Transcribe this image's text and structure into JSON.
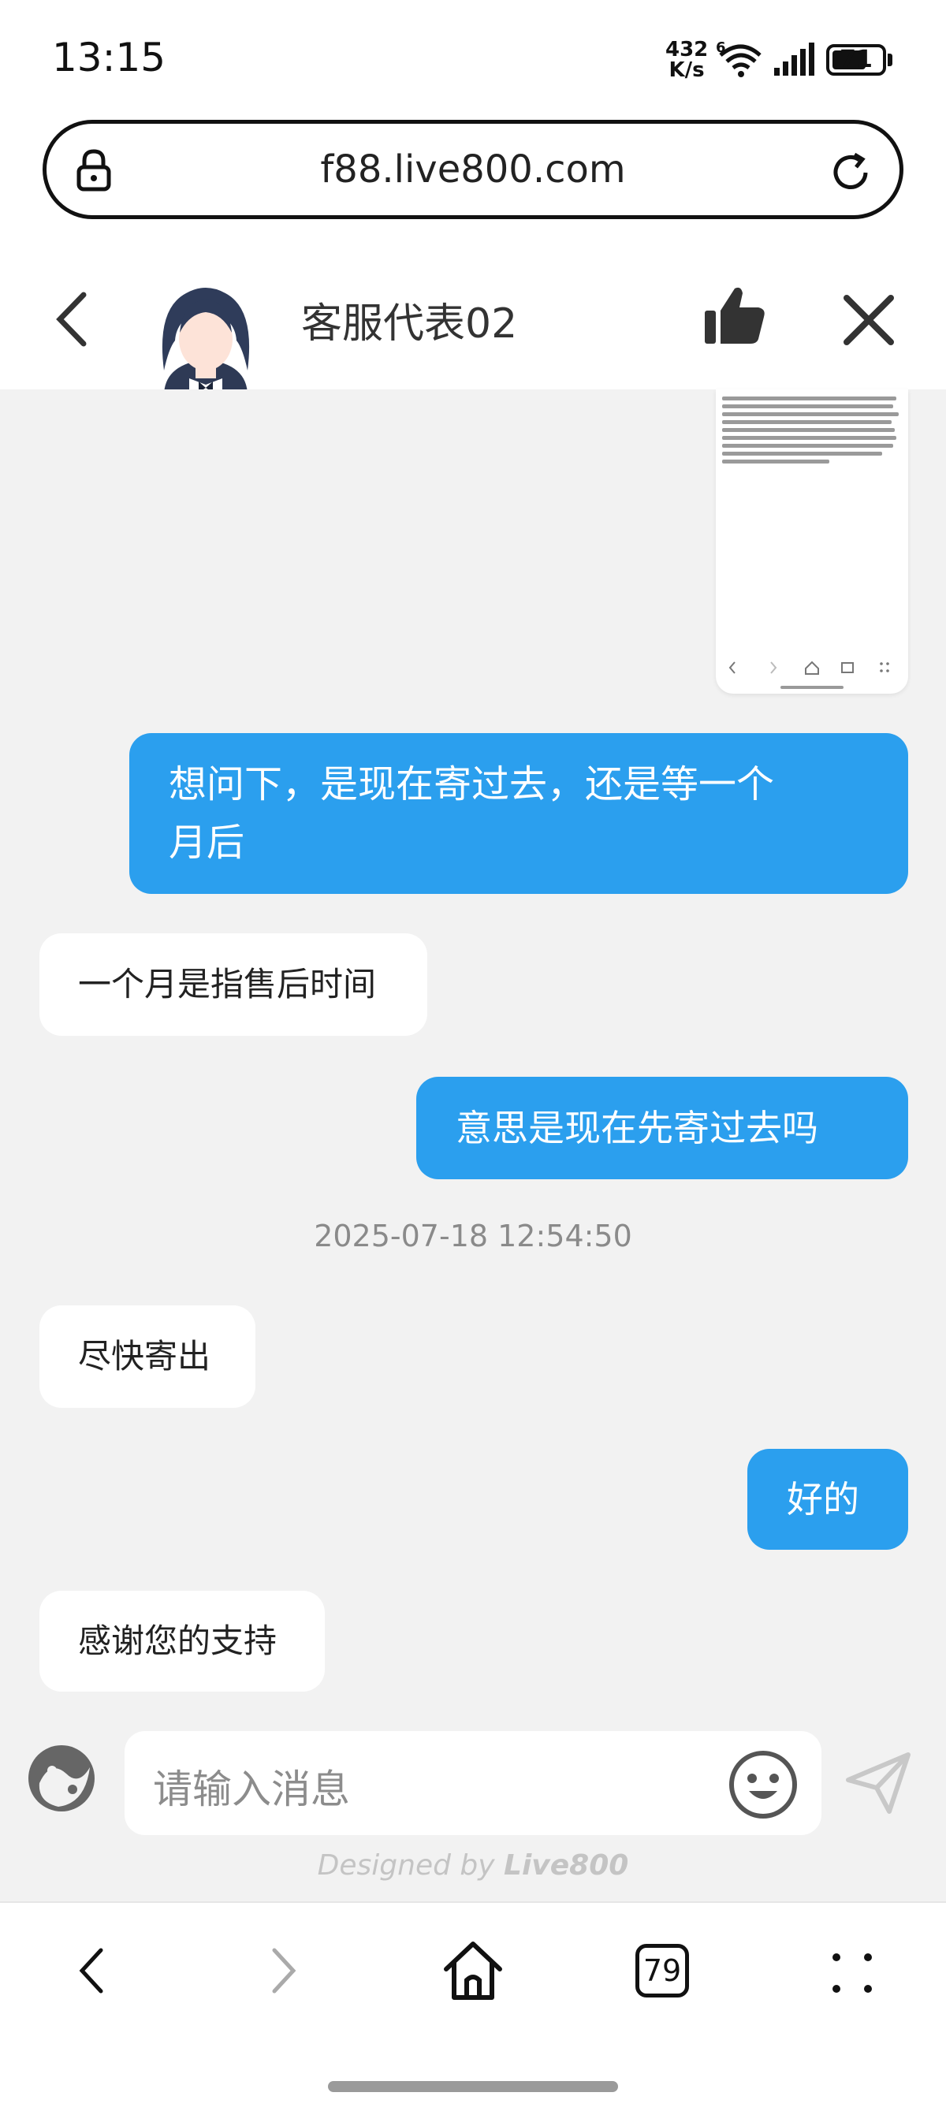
{
  "status_bar": {
    "time": "13:15",
    "net_speed_value": "432",
    "net_speed_unit": "K/s",
    "wifi_label": "6",
    "battery": "71"
  },
  "browser": {
    "url": "f88.live800.com",
    "tab_count": "79"
  },
  "chat": {
    "agent_name": "客服代表02",
    "messages": [
      {
        "dir": "out",
        "text_lines": [
          "想问下，是现在寄过去，还是等一个",
          "月后"
        ]
      },
      {
        "dir": "in",
        "text": "一个月是指售后时间"
      },
      {
        "dir": "out",
        "text": "意思是现在先寄过去吗"
      },
      {
        "dir": "in",
        "text": "尽快寄出"
      },
      {
        "dir": "out",
        "text": "好的"
      },
      {
        "dir": "in",
        "text": "感谢您的支持"
      }
    ],
    "timestamp": "2025-07-18 12:54:50"
  },
  "composer": {
    "placeholder": "请输入消息",
    "designed_by_prefix": "Designed by ",
    "designed_by_brand": "Live800"
  },
  "colors": {
    "outgoing_bubble": "#2b9fee",
    "incoming_bubble": "#ffffff",
    "background": "#f2f2f2"
  },
  "icons": [
    "lock-icon",
    "reload-icon",
    "back-chevron-icon",
    "thumbs-up-icon",
    "close-icon",
    "emoji-icon",
    "smiley-icon",
    "send-icon",
    "nav-back-icon",
    "nav-forward-icon",
    "home-icon",
    "menu-dots-icon",
    "wifi-icon",
    "signal-icon",
    "battery-icon"
  ]
}
